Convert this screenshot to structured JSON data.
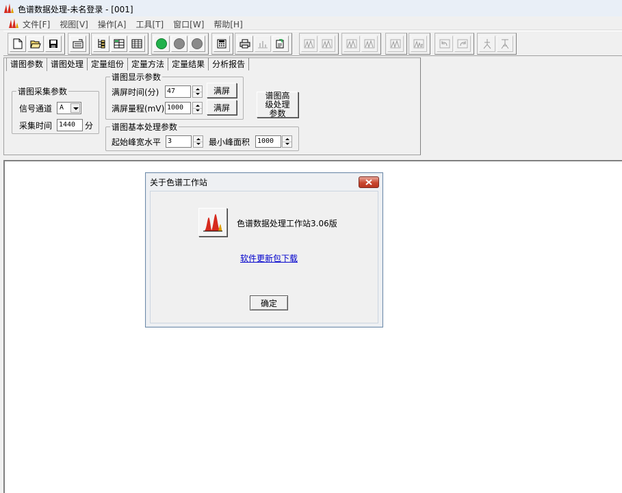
{
  "window": {
    "title": "色谱数据处理-未名登录 - [001]"
  },
  "menu": [
    "文件[F]",
    "视图[V]",
    "操作[A]",
    "工具[T]",
    "窗口[W]",
    "帮助[H]"
  ],
  "toolbar": {
    "groups": [
      [
        "new-file-icon",
        "open-folder-icon",
        "save-icon"
      ],
      [
        "print-preview-icon"
      ],
      [
        "tree-icon",
        "grid-icon",
        "table-icon"
      ],
      [
        "green-circle-icon",
        "gray-circle-icon",
        "gray-circle-icon"
      ],
      [
        "calculator-icon"
      ],
      [
        "printer-icon",
        "chart-icon",
        "export-icon"
      ],
      [
        "peak-icon",
        "peak-icon"
      ],
      [
        "peak-icon",
        "peak-icon"
      ],
      [
        "peak-icon"
      ],
      [
        "peak-text-icon"
      ],
      [
        "undo-icon",
        "redo-icon"
      ],
      [
        "figure-icon",
        "figure-icon"
      ]
    ]
  },
  "tabs": [
    "谱图参数",
    "谱图处理",
    "定量组份",
    "定量方法",
    "定量结果",
    "分析报告"
  ],
  "acquisition": {
    "legend": "谱图采集参数",
    "channel_label": "信号通道",
    "channel_value": "A",
    "time_label": "采集时间",
    "time_value": "1440",
    "time_unit": "分"
  },
  "display": {
    "legend": "谱图显示参数",
    "fullscreen_time_label": "满屏时间(分)",
    "fullscreen_time_value": "47",
    "fullscreen_range_label": "满屏量程(mV)",
    "fullscreen_range_value": "1000",
    "fullscreen_button": "满屏"
  },
  "advanced_button": "谱图高级处理参数",
  "basic": {
    "legend": "谱图基本处理参数",
    "peak_width_label": "起始峰宽水平",
    "peak_width_value": "3",
    "min_area_label": "最小峰面积",
    "min_area_value": "1000"
  },
  "dialog": {
    "title": "关于色谱工作站",
    "version": "色谱数据处理工作站3.06版",
    "link": "软件更新包下载",
    "ok": "确定"
  },
  "colors": {
    "accent_green": "#22b14c",
    "link_blue": "#0000cc",
    "close_red": "#c9472f",
    "logo_red": "#d62a1e"
  }
}
